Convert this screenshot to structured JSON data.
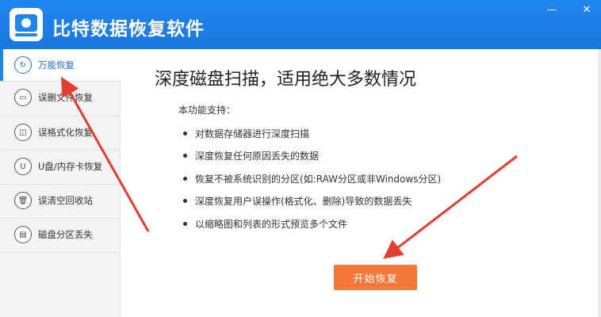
{
  "app": {
    "title": "比特数据恢复软件",
    "minimize_label": "—",
    "close_label": "✕"
  },
  "sidebar": {
    "items": [
      {
        "label": "万能恢复",
        "icon": "refresh-icon",
        "glyph": "↻"
      },
      {
        "label": "误删文件恢复",
        "icon": "drive-icon",
        "glyph": "▭"
      },
      {
        "label": "误格式化恢复",
        "icon": "disk-format-icon",
        "glyph": "◫"
      },
      {
        "label": "U盘/内存卡恢复",
        "icon": "usb-icon",
        "glyph": "U"
      },
      {
        "label": "误清空回收站",
        "icon": "trash-icon",
        "glyph": "🗑"
      },
      {
        "label": "磁盘分区丢失",
        "icon": "partition-icon",
        "glyph": "▤"
      }
    ]
  },
  "main": {
    "heading": "深度磁盘扫描，适用绝大多数情况",
    "subheading": "本功能支持：",
    "features": [
      "对数据存储器进行深度扫描",
      "深度恢复任何原因丢失的数据",
      "恢复不被系统识别的分区(如:RAW分区或非Windows分区)",
      "深度恢复用户误操作(格式化、删除)导致的数据丢失",
      "以缩略图和列表的形式预览多个文件"
    ],
    "start_button": "开始恢复"
  },
  "colors": {
    "titlebar": "#1f86ee",
    "accent": "#f6773a",
    "arrow": "#e43c2f"
  }
}
